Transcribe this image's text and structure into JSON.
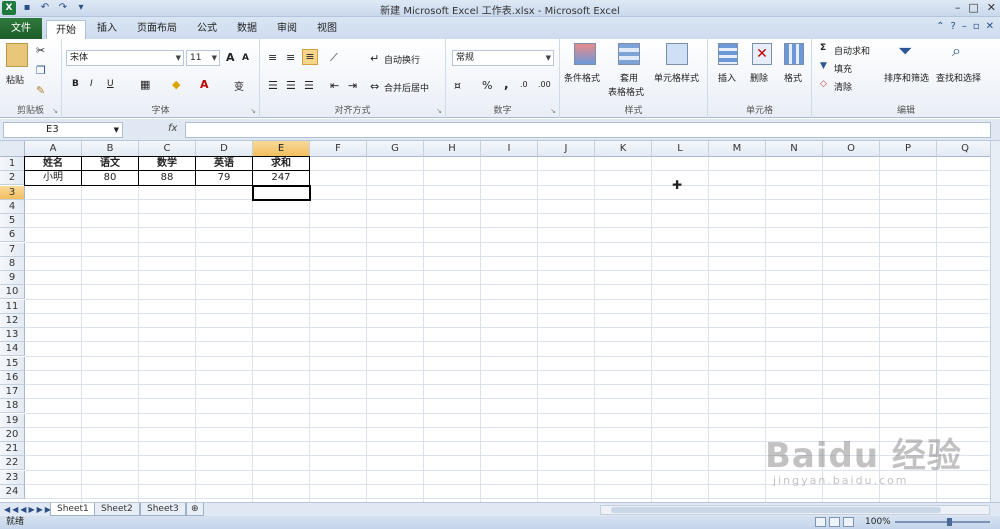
{
  "window": {
    "title": "新建 Microsoft Excel 工作表.xlsx - Microsoft Excel",
    "app_icon": "X"
  },
  "ribbon_tabs": {
    "file": "文件",
    "tabs": [
      "开始",
      "插入",
      "页面布局",
      "公式",
      "数据",
      "审阅",
      "视图"
    ],
    "active": "开始"
  },
  "ribbon": {
    "clipboard": {
      "paste": "粘贴",
      "label": "剪贴板"
    },
    "font": {
      "name": "宋体",
      "size": "11",
      "bold": "B",
      "italic": "I",
      "underline": "U",
      "grow": "A",
      "shrink": "A",
      "label": "字体"
    },
    "alignment": {
      "wrap": "自动换行",
      "merge": "合并后居中",
      "label": "对齐方式"
    },
    "number": {
      "format": "常规",
      "percent": "%",
      "comma": ",",
      "label": "数字"
    },
    "styles": {
      "conditional": "条件格式",
      "table1": "套用",
      "table2": "表格格式",
      "cell_styles": "单元格样式",
      "label": "样式"
    },
    "cells": {
      "insert": "插入",
      "delete": "删除",
      "format": "格式",
      "label": "单元格"
    },
    "editing": {
      "autosum": "自动求和",
      "fill": "填充",
      "clear": "清除",
      "sort": "排序和筛选",
      "find": "查找和选择",
      "label": "编辑"
    }
  },
  "formula_bar": {
    "name_box": "E3",
    "fx": "fx",
    "content": ""
  },
  "columns": [
    "A",
    "B",
    "C",
    "D",
    "E",
    "F",
    "G",
    "H",
    "I",
    "J",
    "K",
    "L",
    "M",
    "N",
    "O",
    "P",
    "Q"
  ],
  "rows": [
    "1",
    "2",
    "3",
    "4",
    "5",
    "6",
    "7",
    "8",
    "9",
    "10",
    "11",
    "12",
    "13",
    "14",
    "15",
    "16",
    "17",
    "18",
    "19",
    "20",
    "21",
    "22",
    "23",
    "24"
  ],
  "cells": {
    "A1": "姓名",
    "B1": "语文",
    "C1": "数学",
    "D1": "英语",
    "E1": "求和",
    "A2": "小明",
    "B2": "80",
    "C2": "88",
    "D2": "79",
    "E2": "247"
  },
  "selected_cell": "E3",
  "sheets": [
    "Sheet1",
    "Sheet2",
    "Sheet3"
  ],
  "active_sheet": "Sheet1",
  "status": {
    "ready": "就绪",
    "zoom": "100%"
  },
  "watermark": {
    "big": "Baidu 经验",
    "small": "jingyan.baidu.com"
  }
}
